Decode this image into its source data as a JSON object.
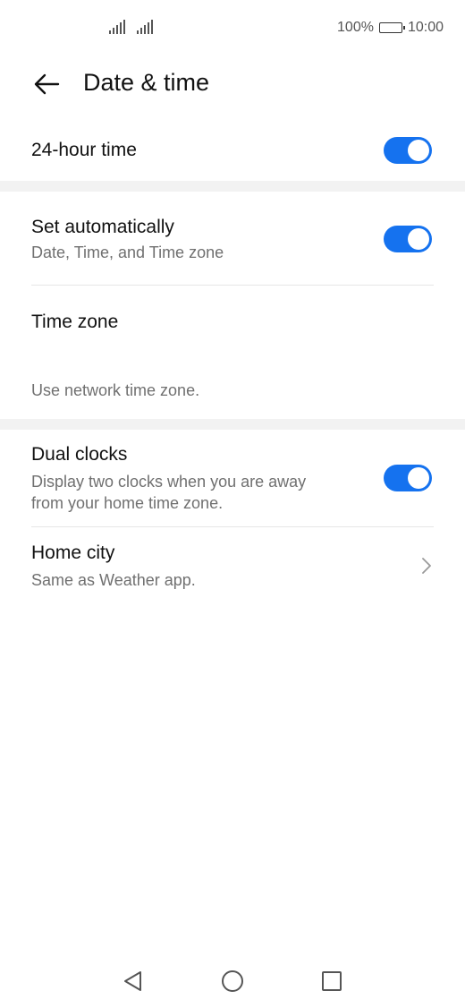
{
  "status_bar": {
    "battery_percent": "100%",
    "time": "10:00",
    "battery_level": 1.0
  },
  "header": {
    "title": "Date & time",
    "back_icon": "arrow-left-icon"
  },
  "settings": {
    "hour24": {
      "title": "24-hour time",
      "enabled": true
    },
    "set_auto": {
      "title": "Set automatically",
      "subtitle": "Date, Time, and Time zone",
      "enabled": true
    },
    "time_zone": {
      "title": "Time zone",
      "subtitle": "Use network time zone."
    },
    "dual_clocks": {
      "title": "Dual clocks",
      "subtitle_line1": "Display two clocks when you are away",
      "subtitle_line2": "from your home time zone.",
      "enabled": true
    },
    "home_city": {
      "title": "Home city",
      "subtitle": "Same as Weather app."
    }
  },
  "colors": {
    "accent": "#1572ef",
    "section_gap": "#f2f2f2",
    "subtitle_text": "#707070"
  },
  "nav": {
    "back": "triangle-back-icon",
    "home": "circle-home-icon",
    "recents": "square-recents-icon"
  }
}
